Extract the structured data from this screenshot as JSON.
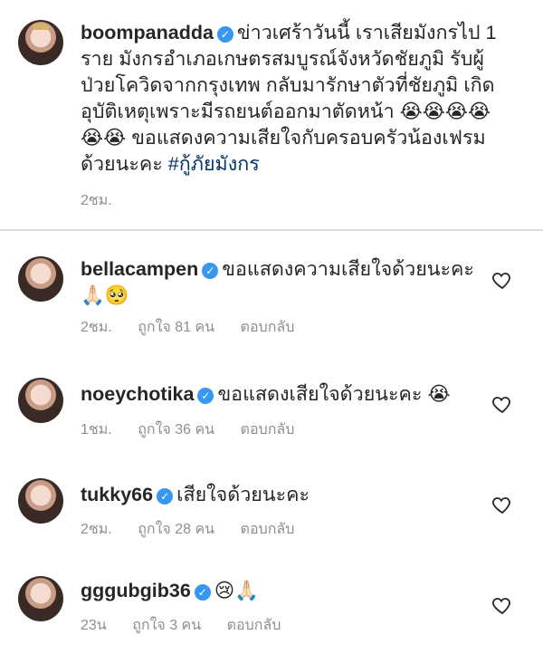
{
  "post": {
    "username": "boompanadda",
    "caption": "ข่าวเศร้าวันนี้ เราเสียมังกรไป 1 ราย มังกรอำเภอเกษตรสมบูรณ์จังหวัดชัยภูมิ รับผู้ป่วยโควิดจากกรุงเทพ กลับมารักษาตัวที่ชัยภูมิ เกิดอุบัติเหตุเพราะมีรถยนต์ออกมาตัดหน้า 😭😭😭😭😭😭 ขอแสดงความเสียใจกับครอบครัวน้องเฟรมด้วยนะคะ",
    "hashtag": "#กู้ภัยมังกร",
    "time": "2ชม."
  },
  "comments": [
    {
      "username": "bellacampen",
      "text": "ขอแสดงความเสียใจด้วยนะคะ🙏🏻🥺",
      "time": "2ชม.",
      "likes": "ถูกใจ 81 คน",
      "reply": "ตอบกลับ"
    },
    {
      "username": "noeychotika",
      "text": "ขอแสดงเสียใจด้วยนะคะ 😭",
      "time": "1ชม.",
      "likes": "ถูกใจ 36 คน",
      "reply": "ตอบกลับ"
    },
    {
      "username": "tukky66",
      "text": "เสียใจด้วยนะคะ",
      "time": "2ชม.",
      "likes": "ถูกใจ 28 คน",
      "reply": "ตอบกลับ"
    },
    {
      "username": "gggubgib36",
      "text": "😢🙏🏻",
      "time": "23น",
      "likes": "ถูกใจ 3 คน",
      "reply": "ตอบกลับ"
    }
  ],
  "icons": {
    "verified": "verified-badge-icon",
    "heart": "heart-outline-icon"
  },
  "colors": {
    "verified": "#3897f0",
    "hashtag": "#003569",
    "meta": "#8e8e8e"
  }
}
